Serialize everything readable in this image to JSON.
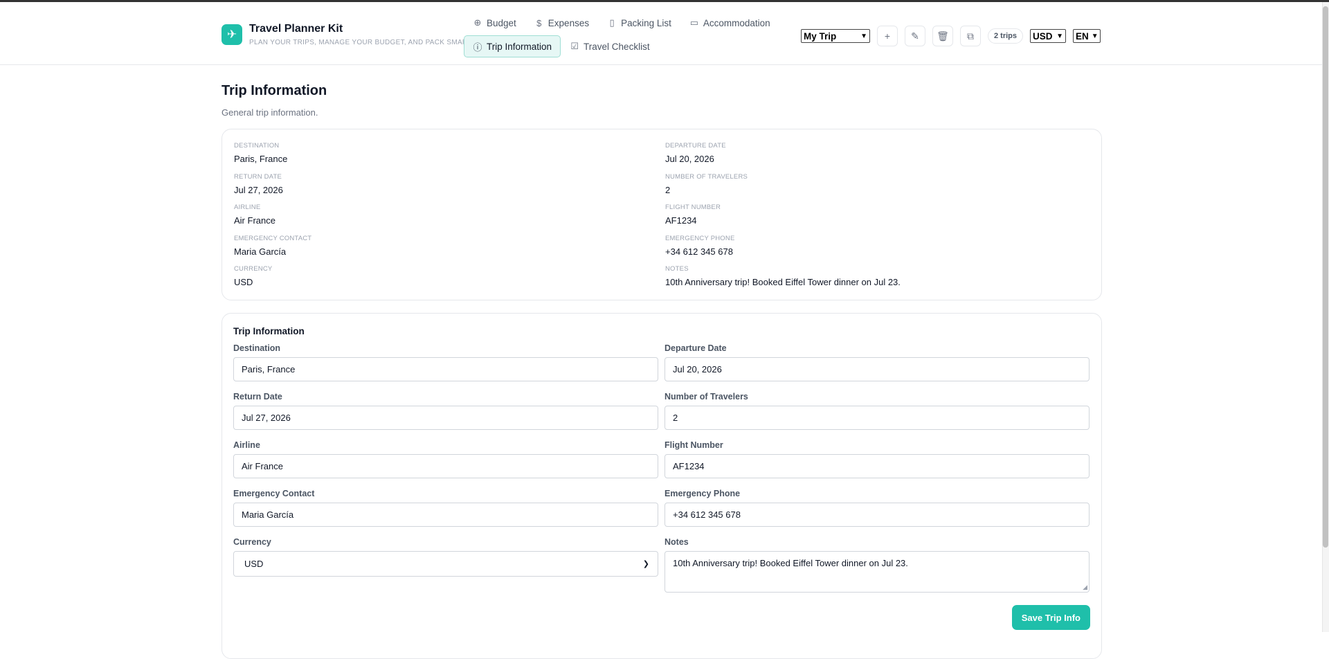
{
  "brand": {
    "title": "Travel Planner Kit",
    "tagline": "PLAN YOUR TRIPS, MANAGE YOUR BUDGET, AND PACK SMART.",
    "logo_icon": "airplane-icon"
  },
  "nav": {
    "row1": [
      {
        "label": "Budget",
        "icon": "budget-icon"
      },
      {
        "label": "Expenses",
        "icon": "dollar-icon"
      },
      {
        "label": "Packing List",
        "icon": "clipboard-icon"
      },
      {
        "label": "Accommodation",
        "icon": "bed-icon"
      }
    ],
    "row2": [
      {
        "label": "Trip Information",
        "icon": "info-icon",
        "active": true
      },
      {
        "label": "Travel Checklist",
        "icon": "checkbox-icon"
      }
    ]
  },
  "tools": {
    "trip_select": "My Trip",
    "trips_count": "2 trips",
    "currency_select": "USD",
    "language_select": "EN"
  },
  "page": {
    "title": "Trip Information",
    "subtitle": "General trip information."
  },
  "summary": {
    "destination_label": "DESTINATION",
    "destination": "Paris, France",
    "departure_label": "DEPARTURE DATE",
    "departure": "Jul 20, 2026",
    "return_label": "RETURN DATE",
    "return": "Jul 27, 2026",
    "travelers_label": "NUMBER OF TRAVELERS",
    "travelers": "2",
    "airline_label": "AIRLINE",
    "airline": "Air France",
    "flight_label": "FLIGHT NUMBER",
    "flight": "AF1234",
    "contact_label": "EMERGENCY CONTACT",
    "contact": "Maria García",
    "phone_label": "EMERGENCY PHONE",
    "phone": "+34 612 345 678",
    "currency_label": "CURRENCY",
    "currency": "USD",
    "notes_label": "NOTES",
    "notes": "10th Anniversary trip! Booked Eiffel Tower dinner on Jul 23."
  },
  "form": {
    "title": "Trip Information",
    "destination_label": "Destination",
    "destination": "Paris, France",
    "departure_label": "Departure Date",
    "departure": "Jul 20, 2026",
    "return_label": "Return Date",
    "return": "Jul 27, 2026",
    "travelers_label": "Number of Travelers",
    "travelers": "2",
    "airline_label": "Airline",
    "airline": "Air France",
    "flight_label": "Flight Number",
    "flight": "AF1234",
    "contact_label": "Emergency Contact",
    "contact": "Maria García",
    "phone_label": "Emergency Phone",
    "phone": "+34 612 345 678",
    "currency_label": "Currency",
    "currency": "USD",
    "notes_label": "Notes",
    "notes": "10th Anniversary trip! Booked Eiffel Tower dinner on Jul 23.",
    "save_label": "Save Trip Info"
  },
  "colors": {
    "accent": "#1fbfaa",
    "active_tab_bg": "#e6f7f5",
    "active_tab_border": "#9fded4"
  }
}
